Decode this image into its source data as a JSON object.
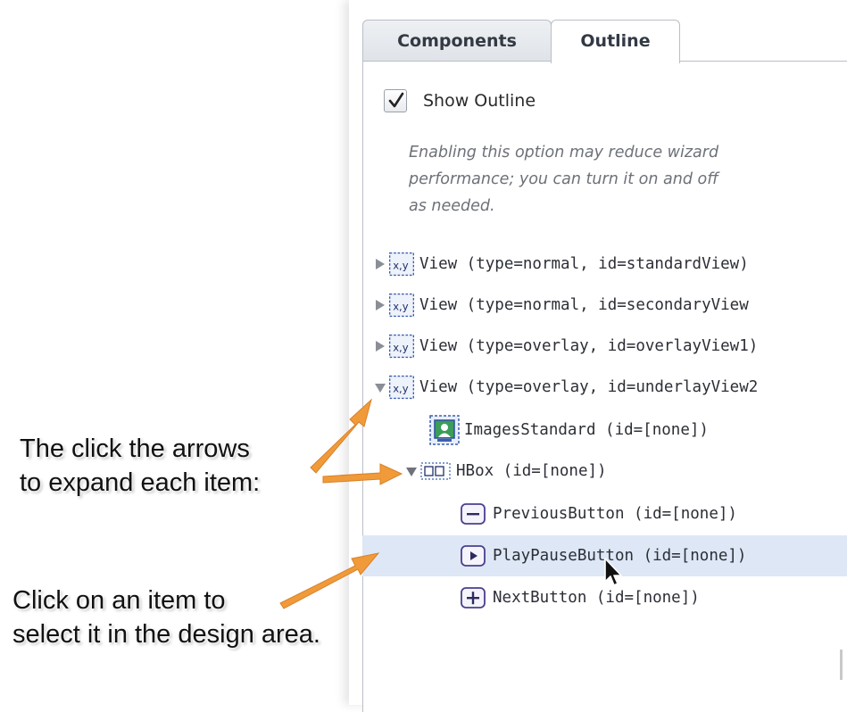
{
  "tabs": [
    {
      "label": "Components",
      "active": false
    },
    {
      "label": "Outline",
      "active": true
    }
  ],
  "outline": {
    "show_label": "Show Outline",
    "checked": true,
    "note_lines": [
      "Enabling this option may reduce wizard",
      "performance; you can turn it on and off",
      "as needed."
    ]
  },
  "tree": [
    {
      "text": "View (type=normal, id=standardView)",
      "icon": "xy-view-icon",
      "arrow": "collapsed"
    },
    {
      "text": "View (type=normal, id=secondaryView",
      "icon": "xy-view-icon",
      "arrow": "collapsed"
    },
    {
      "text": "View (type=overlay, id=overlayView1)",
      "icon": "xy-view-icon",
      "arrow": "collapsed"
    },
    {
      "text": "View (type=overlay, id=underlayView2",
      "icon": "xy-view-icon",
      "arrow": "expanded"
    },
    {
      "text": "ImagesStandard (id=[none])",
      "icon": "image-icon",
      "arrow": "none"
    },
    {
      "text": "HBox (id=[none])",
      "icon": "hbox-icon",
      "arrow": "expanded"
    },
    {
      "text": "PreviousButton (id=[none])",
      "icon": "minus-button-icon",
      "arrow": "none"
    },
    {
      "text": "PlayPauseButton (id=[none])",
      "icon": "play-button-icon",
      "arrow": "none",
      "selected": true
    },
    {
      "text": "NextButton (id=[none])",
      "icon": "plus-button-icon",
      "arrow": "none"
    }
  ],
  "annotations": [
    {
      "lines": [
        "The click the arrows",
        "to expand each item:"
      ]
    },
    {
      "lines": [
        "Click on an item to",
        "select it in the design area."
      ]
    }
  ],
  "colors": {
    "selection": "#dde7f6",
    "arrow": "#f09a3a",
    "icon_accent": "#3b5fb0"
  }
}
